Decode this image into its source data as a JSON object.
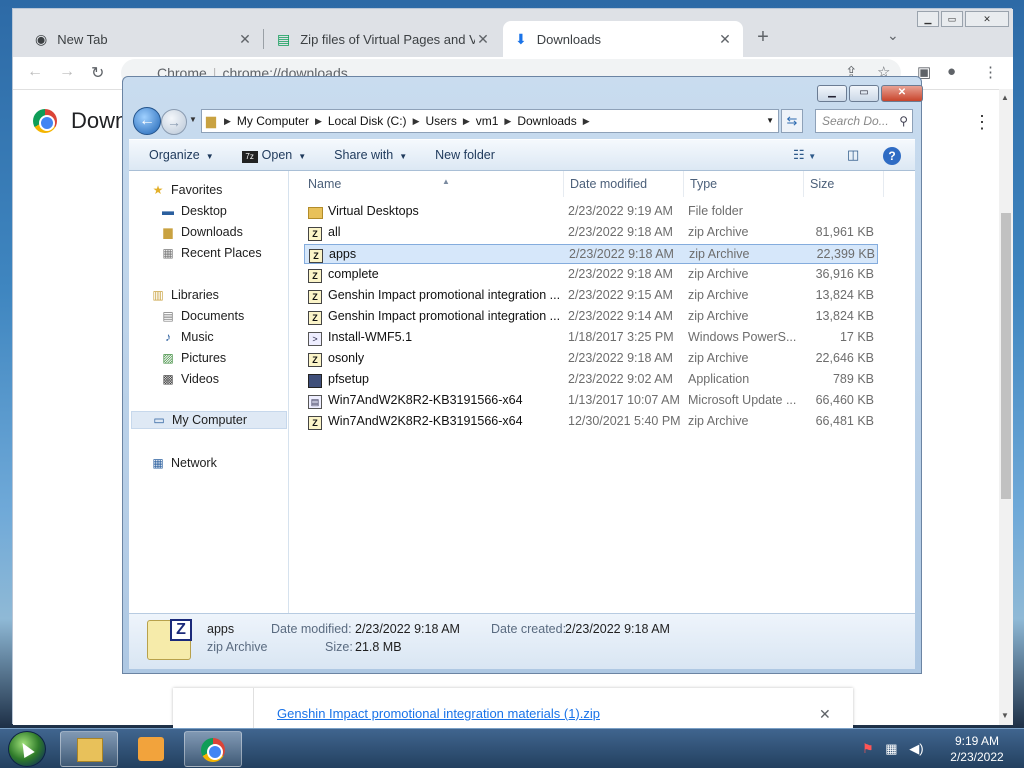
{
  "chrome": {
    "tabs": [
      {
        "title": "New Tab",
        "icon": "chrome-icon"
      },
      {
        "title": "Zip files of Virtual Pages and Virt",
        "icon": "sheets-icon"
      },
      {
        "title": "Downloads",
        "icon": "download-icon"
      }
    ],
    "url_scheme": "Chrome",
    "url": "chrome://downloads",
    "page_title": "Downloads",
    "download_card_link": "Genshin Impact promotional integration materials (1).zip"
  },
  "explorer": {
    "breadcrumbs": [
      "My Computer",
      "Local Disk (C:)",
      "Users",
      "vm1",
      "Downloads"
    ],
    "search_placeholder": "Search Do...",
    "commands": {
      "organize": "Organize",
      "open": "Open",
      "share": "Share with",
      "new_folder": "New folder"
    },
    "nav": {
      "favorites": "Favorites",
      "desktop": "Desktop",
      "downloads": "Downloads",
      "recent": "Recent Places",
      "libraries": "Libraries",
      "documents": "Documents",
      "music": "Music",
      "pictures": "Pictures",
      "videos": "Videos",
      "computer": "My Computer",
      "network": "Network"
    },
    "columns": {
      "name": "Name",
      "date": "Date modified",
      "type": "Type",
      "size": "Size"
    },
    "files": [
      {
        "name": "Virtual Desktops",
        "date": "2/23/2022 9:19 AM",
        "type": "File folder",
        "size": ""
      },
      {
        "name": "all",
        "date": "2/23/2022 9:18 AM",
        "type": "zip Archive",
        "size": "81,961 KB"
      },
      {
        "name": "apps",
        "date": "2/23/2022 9:18 AM",
        "type": "zip Archive",
        "size": "22,399 KB"
      },
      {
        "name": "complete",
        "date": "2/23/2022 9:18 AM",
        "type": "zip Archive",
        "size": "36,916 KB"
      },
      {
        "name": "Genshin Impact promotional integration ...",
        "date": "2/23/2022 9:15 AM",
        "type": "zip Archive",
        "size": "13,824 KB"
      },
      {
        "name": "Genshin Impact promotional integration ...",
        "date": "2/23/2022 9:14 AM",
        "type": "zip Archive",
        "size": "13,824 KB"
      },
      {
        "name": "Install-WMF5.1",
        "date": "1/18/2017 3:25 PM",
        "type": "Windows PowerS...",
        "size": "17 KB"
      },
      {
        "name": "osonly",
        "date": "2/23/2022 9:18 AM",
        "type": "zip Archive",
        "size": "22,646 KB"
      },
      {
        "name": "pfsetup",
        "date": "2/23/2022 9:02 AM",
        "type": "Application",
        "size": "789 KB"
      },
      {
        "name": "Win7AndW2K8R2-KB3191566-x64",
        "date": "1/13/2017 10:07 AM",
        "type": "Microsoft Update ...",
        "size": "66,460 KB"
      },
      {
        "name": "Win7AndW2K8R2-KB3191566-x64",
        "date": "12/30/2021 5:40 PM",
        "type": "zip Archive",
        "size": "66,481 KB"
      }
    ],
    "details": {
      "name": "apps",
      "type": "zip Archive",
      "modified_label": "Date modified:",
      "modified": "2/23/2022 9:18 AM",
      "created_label": "Date created:",
      "created": "2/23/2022 9:18 AM",
      "size_label": "Size:",
      "size": "21.8 MB"
    }
  },
  "taskbar": {
    "time": "9:19 AM",
    "date": "2/23/2022"
  }
}
